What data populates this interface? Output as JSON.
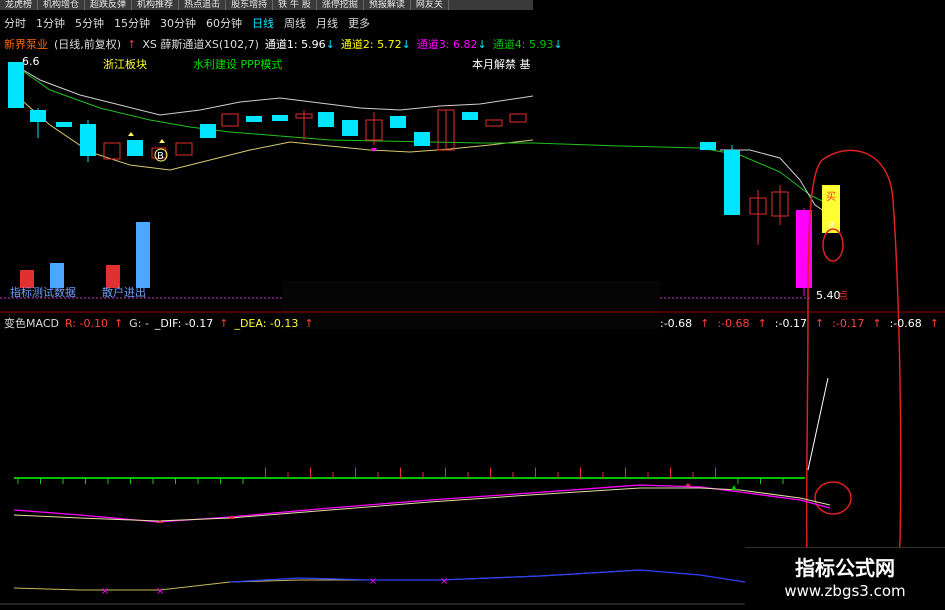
{
  "top_menu": [
    "龙虎榜",
    "机构增仓",
    "超跌反弹",
    "机构推荐",
    "热点追击",
    "股东增持",
    "铁 牛 股",
    "涨停挖掘",
    "预报解读",
    "网友关"
  ],
  "periods": [
    {
      "label": "分时",
      "active": false
    },
    {
      "label": "1分钟",
      "active": false
    },
    {
      "label": "5分钟",
      "active": false
    },
    {
      "label": "15分钟",
      "active": false
    },
    {
      "label": "30分钟",
      "active": false
    },
    {
      "label": "60分钟",
      "active": false
    },
    {
      "label": "日线",
      "active": true
    },
    {
      "label": "周线",
      "active": false
    },
    {
      "label": "月线",
      "active": false
    },
    {
      "label": "更多",
      "active": false
    }
  ],
  "stock_header": {
    "name": "新界泵业",
    "mode": "(日线,前复权)",
    "indicator": "XS 薛斯通道XS(102,7)",
    "ch1_label": "通道1:",
    "ch1_value": "5.96",
    "ch2_label": "通道2:",
    "ch2_value": "5.72",
    "ch3_label": "通道3:",
    "ch3_value": "6.82",
    "ch4_label": "通道4:",
    "ch4_value": "5.93"
  },
  "price_label_top": "6.6",
  "tags": {
    "block": "浙江板块",
    "concept": "水利建设 PPP模式",
    "unlock": "本月解禁 基"
  },
  "annotations": {
    "b1": "B",
    "b2": "B",
    "buy": "买",
    "low_price": "5.40",
    "dotted_label_left": "指标测试数据",
    "dotted_label_mid": "散户进出",
    "red_point": "点"
  },
  "macd_header": {
    "name": "变色MACD",
    "r": "R: -0.10",
    "g": "G: -",
    "dif": "_DIF: -0.17",
    "dea": "_DEA: -0.13",
    "right_vals": [
      ":-0.68",
      ":-0.68",
      ":-0.17",
      ":-0.17",
      ":-0.68"
    ]
  },
  "watermark": {
    "title": "指标公式网",
    "url": "www.zbgs3.com"
  },
  "colors": {
    "up": "#e03030",
    "down": "#00e5ff",
    "magenta": "#ff00ff",
    "yellow": "#ffff00",
    "green": "#00c000",
    "white": "#dddddd",
    "buy_box": "#ffff33"
  }
}
